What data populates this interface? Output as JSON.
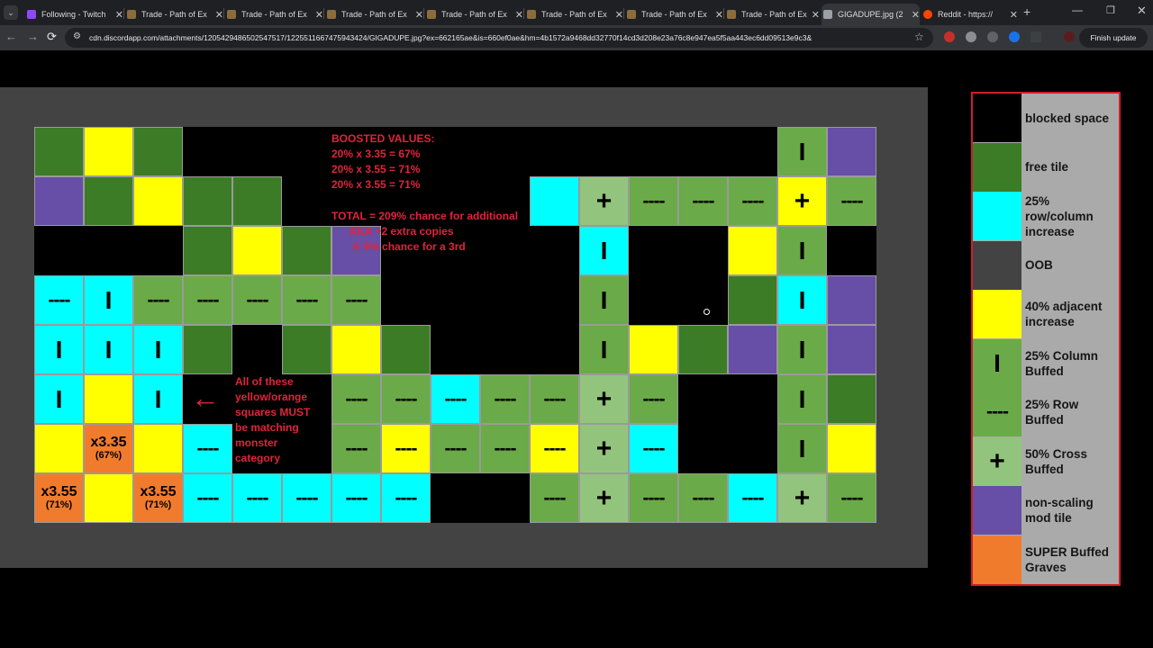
{
  "browser": {
    "tabs": [
      {
        "title": "Following - Twitch",
        "favicon": "twitch-icon",
        "active": false
      },
      {
        "title": "Trade - Path of Ex",
        "favicon": "poe-icon",
        "active": false
      },
      {
        "title": "Trade - Path of Ex",
        "favicon": "poe-icon",
        "active": false
      },
      {
        "title": "Trade - Path of Ex",
        "favicon": "poe-icon",
        "active": false
      },
      {
        "title": "Trade - Path of Ex",
        "favicon": "poe-icon",
        "active": false
      },
      {
        "title": "Trade - Path of Ex",
        "favicon": "poe-icon",
        "active": false
      },
      {
        "title": "Trade - Path of Ex",
        "favicon": "poe-icon",
        "active": false
      },
      {
        "title": "Trade - Path of Ex",
        "favicon": "poe-icon",
        "active": false
      },
      {
        "title": "GIGADUPE.jpg (2",
        "favicon": "image-icon",
        "active": true
      },
      {
        "title": "Reddit - https://",
        "favicon": "reddit-icon",
        "active": false
      }
    ],
    "new_tab": "+",
    "url": "cdn.discordapp.com/attachments/1205429486502547517/1225511667475943424/GIGADUPE.jpg?ex=662165ae&is=660ef0ae&hm=4b1572a9468dd32770f14cd3d208e23a76c8e947ea5f5aa443ec6dd09513e9c3&",
    "finish_update": "Finish update"
  },
  "colors": {
    "blocked": "#000000",
    "free": "#3c7c27",
    "cyan": "#00ffff",
    "oob": "#434343",
    "yellow": "#ffff00",
    "col": "#6aaa48",
    "row": "#6aaa48",
    "cross": "#93c47d",
    "purple": "#674ea7",
    "orange": "#f17b2c"
  },
  "symbols": {
    "row": "----",
    "col": "I",
    "cross": "+"
  },
  "grid": {
    "cols": 17,
    "rows": [
      [
        "F",
        "Y",
        "F",
        "B",
        "B",
        "B",
        "B",
        "B",
        "B",
        "B",
        "B",
        "B",
        "B",
        "B",
        "B",
        "C",
        "P"
      ],
      [
        "P",
        "F",
        "Y",
        "F",
        "F",
        "B",
        "B",
        "B",
        "B",
        "B",
        "X",
        "K",
        "R",
        "R",
        "R",
        "Y+",
        "R"
      ],
      [
        "B",
        "B",
        "B",
        "F",
        "Y",
        "F",
        "P",
        "B",
        "B",
        "B",
        "B",
        "Xc",
        "B",
        "B",
        "Y",
        "C",
        "B"
      ],
      [
        "Xr",
        "Xc",
        "R",
        "R",
        "R",
        "R",
        "R",
        "B",
        "B",
        "B",
        "B",
        "C",
        "B",
        "B",
        "F",
        "Xc",
        "P"
      ],
      [
        "Xc",
        "Xc",
        "Xc",
        "F",
        "B",
        "F",
        "Y",
        "F",
        "B",
        "B",
        "B",
        "C",
        "Y",
        "F",
        "P",
        "C",
        "P"
      ],
      [
        "Xc",
        "Y",
        "Xc",
        "B",
        "B",
        "B",
        "R",
        "R",
        "Xr",
        "R",
        "R",
        "K",
        "R",
        "B",
        "B",
        "C",
        "F"
      ],
      [
        "Y",
        "O1",
        "Y",
        "Xr",
        "B",
        "B",
        "R",
        "Yr",
        "R",
        "R",
        "R",
        "K",
        "Xr",
        "B",
        "B",
        "C",
        "Y"
      ],
      [
        "O2",
        "Y",
        "O3",
        "Xr",
        "Xr",
        "Xr",
        "Xr",
        "Xr",
        "B",
        "B",
        "B",
        "R",
        "K",
        "R",
        "R",
        "Xr",
        "K",
        "R"
      ]
    ],
    "multipliers": {
      "O1": {
        "main": "x3.35",
        "sub": "(67%)"
      },
      "O2": {
        "main": "x3.55",
        "sub": "(71%)"
      },
      "O3": {
        "main": "x3.55",
        "sub": "(71%)"
      }
    }
  },
  "annotations": {
    "boosted": "BOOSTED VALUES:\n20% x 3.35 = 67%\n20% x 3.55 = 71%\n20% x 3.55 = 71%",
    "total": "TOTAL = 209% chance for additional\n      AKA +2 extra copies\n       & 9% chance for a 3rd",
    "note": "All of these\nyellow/orange\nsquares MUST\nbe matching\nmonster\ncategory",
    "arrow": "←"
  },
  "legend": [
    {
      "label": "blocked space",
      "swatch": "B"
    },
    {
      "label": "free tile",
      "swatch": "F"
    },
    {
      "label": "25%\nrow/column\nincrease",
      "swatch": "X"
    },
    {
      "label": "OOB",
      "swatch": "OOB"
    },
    {
      "label": "40% adjacent\nincrease",
      "swatch": "Y"
    },
    {
      "label": "25% Column\nBuffed",
      "swatch": "C"
    },
    {
      "label": "25% Row\nBuffed",
      "swatch": "R"
    },
    {
      "label": "50% Cross\nBuffed",
      "swatch": "K"
    },
    {
      "label": "non-scaling\nmod tile",
      "swatch": "P"
    },
    {
      "label": "SUPER Buffed\nGraves",
      "swatch": "O"
    }
  ]
}
